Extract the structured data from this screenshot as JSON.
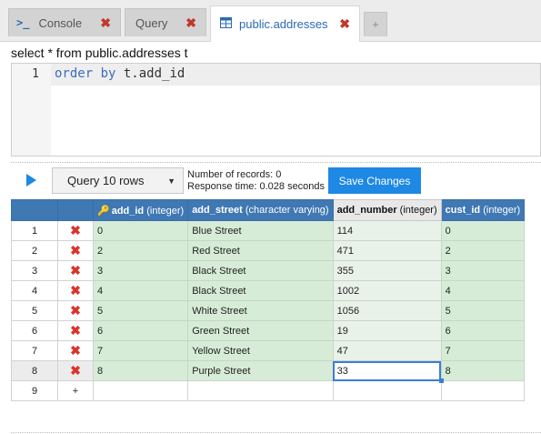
{
  "tabs": [
    {
      "label": "Console",
      "icon": "terminal-icon"
    },
    {
      "label": "Query",
      "icon": ""
    },
    {
      "label": "public.addresses",
      "icon": "table-icon"
    }
  ],
  "add_tab_label": "+",
  "editor": {
    "title": "select * from public.addresses t",
    "line_number": "1",
    "code_keyword": "order by",
    "code_rest": " t.add_id"
  },
  "toolbar": {
    "query_select": "Query 10 rows",
    "records_text": "Number of records: 0",
    "response_text": "Response time: 0.028 seconds",
    "save_label": "Save Changes"
  },
  "grid": {
    "columns": [
      {
        "name": "add_id",
        "type": "(integer)"
      },
      {
        "name": "add_street",
        "type": "(character varying)"
      },
      {
        "name": "add_number",
        "type": "(integer)"
      },
      {
        "name": "cust_id",
        "type": "(integer)"
      }
    ],
    "rows": [
      {
        "num": "1",
        "cells": [
          "0",
          "Blue Street",
          "114",
          "0"
        ]
      },
      {
        "num": "2",
        "cells": [
          "2",
          "Red Street",
          "471",
          "2"
        ]
      },
      {
        "num": "3",
        "cells": [
          "3",
          "Black Street",
          "355",
          "3"
        ]
      },
      {
        "num": "4",
        "cells": [
          "4",
          "Black Street",
          "1002",
          "4"
        ]
      },
      {
        "num": "5",
        "cells": [
          "5",
          "White Street",
          "1056",
          "5"
        ]
      },
      {
        "num": "6",
        "cells": [
          "6",
          "Green Street",
          "19",
          "6"
        ]
      },
      {
        "num": "7",
        "cells": [
          "7",
          "Yellow Street",
          "47",
          "7"
        ]
      },
      {
        "num": "8",
        "cells": [
          "8",
          "Purple Street",
          "33",
          "8"
        ]
      }
    ],
    "new_row_num": "9",
    "new_row_add": "+",
    "delete_glyph": "✖"
  },
  "colors": {
    "accent": "#1e88e5",
    "header": "#3f78b3",
    "row": "#d7ecd7",
    "delete": "#d9342b"
  }
}
